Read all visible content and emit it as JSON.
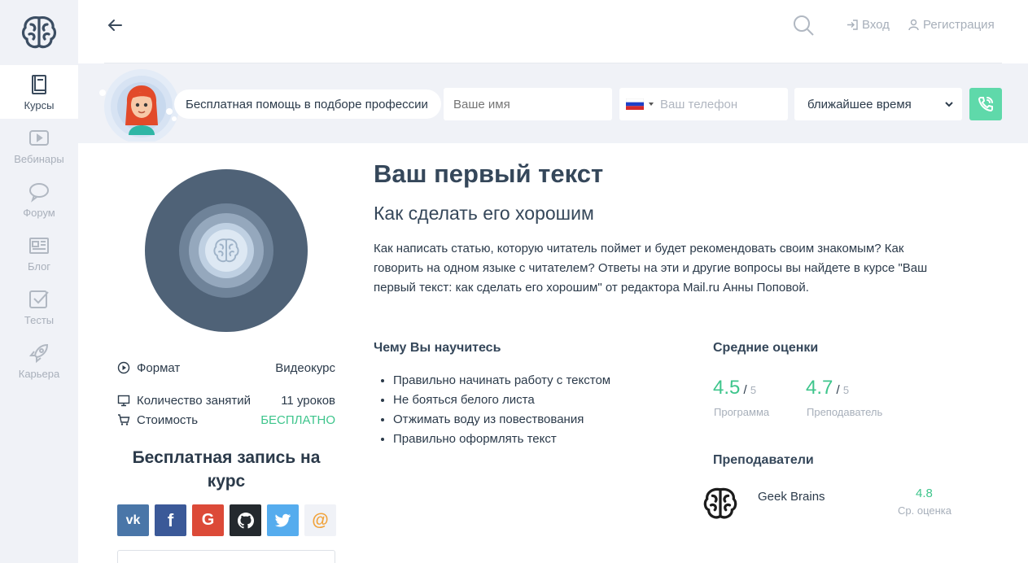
{
  "sidebar": {
    "items": [
      {
        "label": "Курсы",
        "icon": "book-icon",
        "active": true
      },
      {
        "label": "Вебинары",
        "icon": "video-icon",
        "active": false
      },
      {
        "label": "Форум",
        "icon": "chat-icon",
        "active": false
      },
      {
        "label": "Блог",
        "icon": "newspaper-icon",
        "active": false
      },
      {
        "label": "Тесты",
        "icon": "checkbox-icon",
        "active": false
      },
      {
        "label": "Карьера",
        "icon": "rocket-icon",
        "active": false
      }
    ]
  },
  "header": {
    "login_label": "Вход",
    "register_label": "Регистрация"
  },
  "banner": {
    "help_text": "Бесплатная помощь в подборе профессии",
    "name_placeholder": "Ваше имя",
    "phone_placeholder": "Ваш телефон",
    "time_select": "ближайшее время"
  },
  "course": {
    "title": "Ваш первый текст",
    "subtitle": "Как сделать его хорошим",
    "description": "Как написать статью, которую читатель поймет и будет рекомендовать своим знакомым? Как говорить на одном языке с читателем? Ответы на эти и другие вопросы вы найдете в курсе \"Ваш первый текст: как сделать его хорошим\" от редактора Mail.ru Анны Поповой.",
    "info": {
      "format_label": "Формат",
      "format_value": "Видеокурс",
      "lessons_label": "Количество занятий",
      "lessons_value": "11 уроков",
      "price_label": "Стоимость",
      "price_value": "БЕСПЛАТНО"
    }
  },
  "enroll": {
    "title": "Бесплатная запись на курс",
    "social": [
      "vk",
      "facebook",
      "google",
      "github",
      "twitter",
      "mail"
    ]
  },
  "learn": {
    "heading": "Чему Вы научитесь",
    "items": [
      "Правильно начинать работу с текстом",
      "Не бояться белого листа",
      "Отжимать воду из повествования",
      "Правильно оформлять текст"
    ]
  },
  "ratings": {
    "heading": "Средние оценки",
    "program": {
      "value": "4.5",
      "max": "5",
      "label": "Программа"
    },
    "teacher": {
      "value": "4.7",
      "max": "5",
      "label": "Преподаватель"
    }
  },
  "teachers": {
    "heading": "Преподаватели",
    "list": [
      {
        "name": "Geek Brains",
        "score": "4.8",
        "score_label": "Ср. оценка"
      }
    ]
  },
  "colors": {
    "accent_green": "#3ec58c",
    "call_button": "#5fd9aa",
    "sidebar_bg": "#f0f2f7",
    "text_dark": "#35475a"
  }
}
